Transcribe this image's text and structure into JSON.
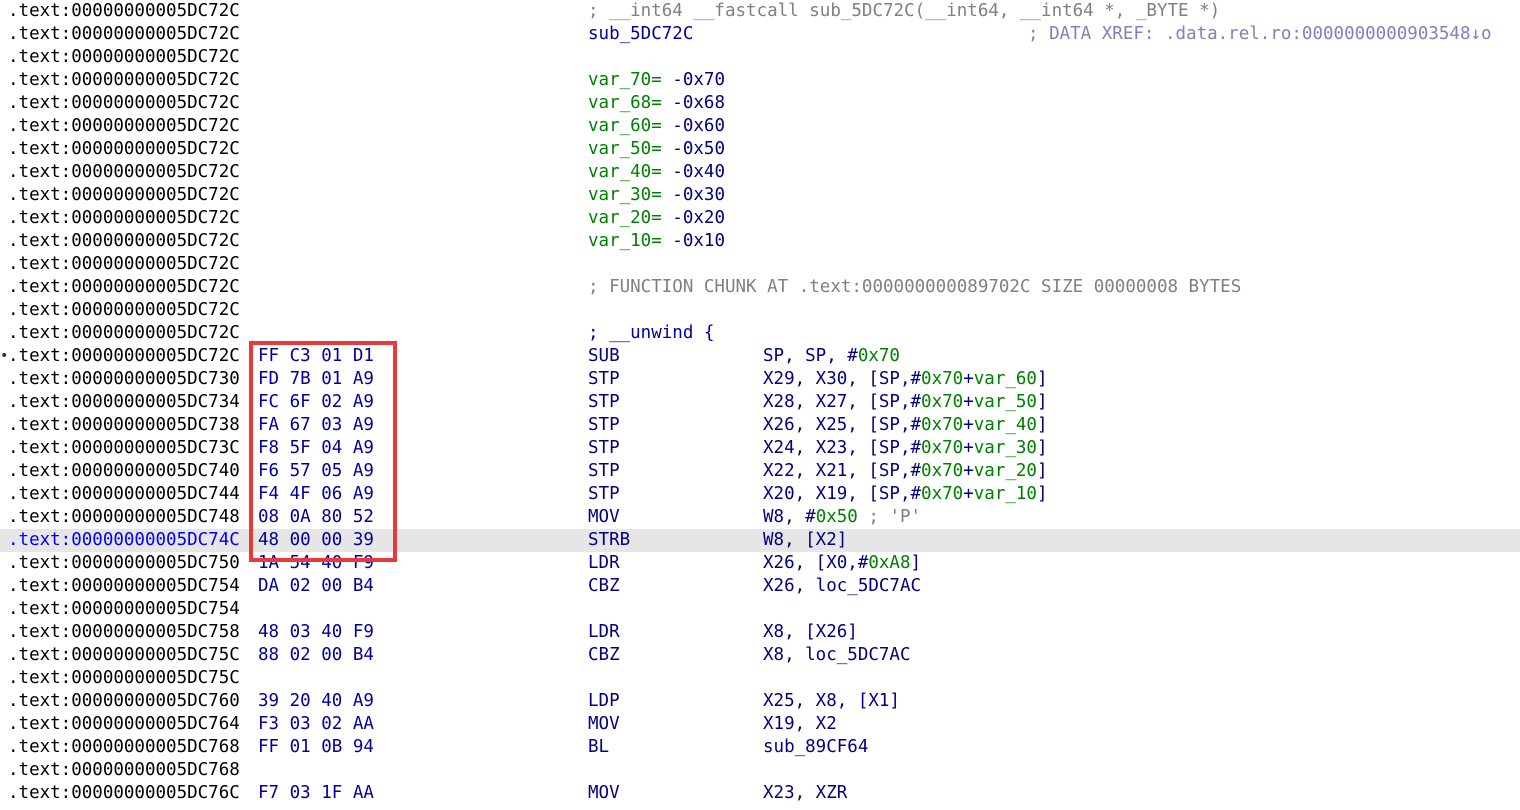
{
  "colors": {
    "address": "#000000",
    "current_address": "#0000ff",
    "bytes": "#0000a0",
    "instruction": "#000080",
    "comment": "#808080",
    "variable": "#008000",
    "immediate": "#008000",
    "current_line_bg": "#e6e6e6",
    "highlight_box": "#e8393b"
  },
  "lines": [
    {
      "addr": ".text:00000000005DC72C",
      "comment": "; __int64 __fastcall sub_5DC72C(__int64, __int64 *, _BYTE *)"
    },
    {
      "addr": ".text:00000000005DC72C",
      "label": "sub_5DC72C",
      "xref": "; DATA XREF: .data.rel.ro:0000000000903548↓o"
    },
    {
      "addr": ".text:00000000005DC72C"
    },
    {
      "addr": ".text:00000000005DC72C",
      "var_name": "var_70=",
      "var_value": " -0x70"
    },
    {
      "addr": ".text:00000000005DC72C",
      "var_name": "var_68=",
      "var_value": " -0x68"
    },
    {
      "addr": ".text:00000000005DC72C",
      "var_name": "var_60=",
      "var_value": " -0x60"
    },
    {
      "addr": ".text:00000000005DC72C",
      "var_name": "var_50=",
      "var_value": " -0x50"
    },
    {
      "addr": ".text:00000000005DC72C",
      "var_name": "var_40=",
      "var_value": " -0x40"
    },
    {
      "addr": ".text:00000000005DC72C",
      "var_name": "var_30=",
      "var_value": " -0x30"
    },
    {
      "addr": ".text:00000000005DC72C",
      "var_name": "var_20=",
      "var_value": " -0x20"
    },
    {
      "addr": ".text:00000000005DC72C",
      "var_name": "var_10=",
      "var_value": " -0x10"
    },
    {
      "addr": ".text:00000000005DC72C"
    },
    {
      "addr": ".text:00000000005DC72C",
      "comment": "; FUNCTION CHUNK AT .text:000000000089702C SIZE 00000008 BYTES"
    },
    {
      "addr": ".text:00000000005DC72C"
    },
    {
      "addr": ".text:00000000005DC72C",
      "label": "; __unwind {"
    },
    {
      "marker": "•",
      "addr": ".text:00000000005DC72C",
      "bytes": "FF C3 01 D1",
      "mnem": "SUB",
      "operands": [
        {
          "t": "SP, SP, #"
        },
        {
          "t": "0x70",
          "c": "num"
        }
      ]
    },
    {
      "addr": ".text:00000000005DC730",
      "bytes": "FD 7B 01 A9",
      "mnem": "STP",
      "operands": [
        {
          "t": "X29, X30, [SP,#"
        },
        {
          "t": "0x70",
          "c": "num"
        },
        {
          "t": "+"
        },
        {
          "t": "var_60",
          "c": "num"
        },
        {
          "t": "]"
        }
      ]
    },
    {
      "addr": ".text:00000000005DC734",
      "bytes": "FC 6F 02 A9",
      "mnem": "STP",
      "operands": [
        {
          "t": "X28, X27, [SP,#"
        },
        {
          "t": "0x70",
          "c": "num"
        },
        {
          "t": "+"
        },
        {
          "t": "var_50",
          "c": "num"
        },
        {
          "t": "]"
        }
      ]
    },
    {
      "addr": ".text:00000000005DC738",
      "bytes": "FA 67 03 A9",
      "mnem": "STP",
      "operands": [
        {
          "t": "X26, X25, [SP,#"
        },
        {
          "t": "0x70",
          "c": "num"
        },
        {
          "t": "+"
        },
        {
          "t": "var_40",
          "c": "num"
        },
        {
          "t": "]"
        }
      ]
    },
    {
      "addr": ".text:00000000005DC73C",
      "bytes": "F8 5F 04 A9",
      "mnem": "STP",
      "operands": [
        {
          "t": "X24, X23, [SP,#"
        },
        {
          "t": "0x70",
          "c": "num"
        },
        {
          "t": "+"
        },
        {
          "t": "var_30",
          "c": "num"
        },
        {
          "t": "]"
        }
      ]
    },
    {
      "addr": ".text:00000000005DC740",
      "bytes": "F6 57 05 A9",
      "mnem": "STP",
      "operands": [
        {
          "t": "X22, X21, [SP,#"
        },
        {
          "t": "0x70",
          "c": "num"
        },
        {
          "t": "+"
        },
        {
          "t": "var_20",
          "c": "num"
        },
        {
          "t": "]"
        }
      ]
    },
    {
      "addr": ".text:00000000005DC744",
      "bytes": "F4 4F 06 A9",
      "mnem": "STP",
      "operands": [
        {
          "t": "X20, X19, [SP,#"
        },
        {
          "t": "0x70",
          "c": "num"
        },
        {
          "t": "+"
        },
        {
          "t": "var_10",
          "c": "num"
        },
        {
          "t": "]"
        }
      ]
    },
    {
      "addr": ".text:00000000005DC748",
      "bytes": "08 0A 80 52",
      "mnem": "MOV",
      "operands": [
        {
          "t": "W8, #"
        },
        {
          "t": "0x50",
          "c": "num"
        },
        {
          "t": " ; 'P'",
          "c": "cmt"
        }
      ]
    },
    {
      "addr": ".text:00000000005DC74C",
      "current": true,
      "bytes": "48 00 00 39",
      "mnem": "STRB",
      "operands": [
        {
          "t": "W8, [X2]"
        }
      ]
    },
    {
      "addr": ".text:00000000005DC750",
      "bytes": "1A 54 40 F9",
      "mnem": "LDR",
      "operands": [
        {
          "t": "X26, [X0,#"
        },
        {
          "t": "0xA8",
          "c": "num"
        },
        {
          "t": "]"
        }
      ]
    },
    {
      "addr": ".text:00000000005DC754",
      "bytes": "DA 02 00 B4",
      "mnem": "CBZ",
      "operands": [
        {
          "t": "X26, loc_5DC7AC"
        }
      ]
    },
    {
      "addr": ".text:00000000005DC754"
    },
    {
      "addr": ".text:00000000005DC758",
      "bytes": "48 03 40 F9",
      "mnem": "LDR",
      "operands": [
        {
          "t": "X8, [X26]"
        }
      ]
    },
    {
      "addr": ".text:00000000005DC75C",
      "bytes": "88 02 00 B4",
      "mnem": "CBZ",
      "operands": [
        {
          "t": "X8, loc_5DC7AC"
        }
      ]
    },
    {
      "addr": ".text:00000000005DC75C"
    },
    {
      "addr": ".text:00000000005DC760",
      "bytes": "39 20 40 A9",
      "mnem": "LDP",
      "operands": [
        {
          "t": "X25, X8, [X1]"
        }
      ]
    },
    {
      "addr": ".text:00000000005DC764",
      "bytes": "F3 03 02 AA",
      "mnem": "MOV",
      "operands": [
        {
          "t": "X19, X2"
        }
      ]
    },
    {
      "addr": ".text:00000000005DC768",
      "bytes": "FF 01 0B 94",
      "mnem": "BL",
      "operands": [
        {
          "t": "sub_89CF64"
        }
      ]
    },
    {
      "addr": ".text:00000000005DC768"
    },
    {
      "addr": ".text:00000000005DC76C",
      "bytes": "F7 03 1F AA",
      "mnem": "MOV",
      "operands": [
        {
          "t": "X23, XZR"
        }
      ]
    }
  ]
}
